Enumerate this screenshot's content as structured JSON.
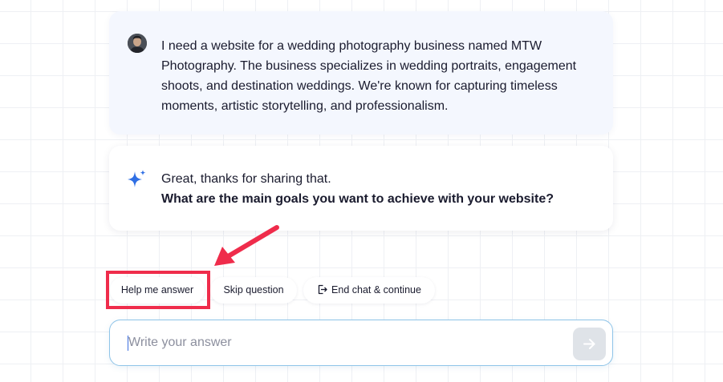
{
  "conversation": {
    "user_message": "I need a website for a wedding photography business named MTW Photography. The business specializes in wedding portraits, engagement shoots, and destination weddings. We're known for capturing timeless moments, artistic storytelling, and professionalism.",
    "ai_message": {
      "intro": "Great, thanks for sharing that.",
      "question": "What are the main goals you want to achieve with your website?"
    }
  },
  "actions": {
    "help_label": "Help me answer",
    "skip_label": "Skip question",
    "end_label": "End chat & continue"
  },
  "input": {
    "placeholder": "Write your answer",
    "value": ""
  },
  "icons": {
    "user_avatar": "avatar-photo",
    "ai": "sparkle-icon",
    "end_chat": "exit-door-icon",
    "send": "arrow-right-icon"
  },
  "colors": {
    "highlight": "#ef2c4b",
    "sparkle": "#2f6fe4",
    "input_border": "#8fc4e8",
    "send_button_bg": "#dfe3e8"
  }
}
